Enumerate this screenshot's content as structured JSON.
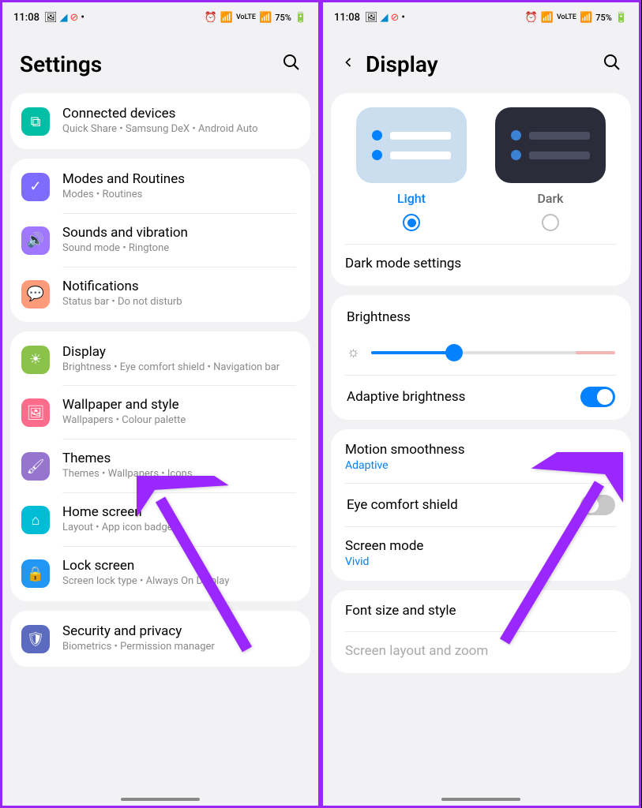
{
  "status": {
    "time": "11:08",
    "battery": "75%",
    "signal": "VoLTE",
    "icons": [
      "🖼",
      "✈",
      "⭕"
    ]
  },
  "left": {
    "title": "Settings",
    "items": [
      {
        "icon": "teal",
        "glyph": "⧉",
        "title": "Connected devices",
        "sub": "Quick Share  •  Samsung DeX  •  Android Auto"
      },
      {
        "icon": "purple",
        "glyph": "✓",
        "title": "Modes and Routines",
        "sub": "Modes  •  Routines"
      },
      {
        "icon": "purple2",
        "glyph": "🔊",
        "title": "Sounds and vibration",
        "sub": "Sound mode  •  Ringtone"
      },
      {
        "icon": "peach",
        "glyph": "💬",
        "title": "Notifications",
        "sub": "Status bar  •  Do not disturb"
      },
      {
        "icon": "green",
        "glyph": "☀",
        "title": "Display",
        "sub": "Brightness  •  Eye comfort shield  •  Navigation bar"
      },
      {
        "icon": "pink",
        "glyph": "🖼",
        "title": "Wallpaper and style",
        "sub": "Wallpapers  •  Colour palette"
      },
      {
        "icon": "violet",
        "glyph": "🖌",
        "title": "Themes",
        "sub": "Themes  •  Wallpapers  •  Icons"
      },
      {
        "icon": "cyan",
        "glyph": "⌂",
        "title": "Home screen",
        "sub": "Layout  •  App icon badges"
      },
      {
        "icon": "blue",
        "glyph": "🔒",
        "title": "Lock screen",
        "sub": "Screen lock type  •  Always On Display"
      },
      {
        "icon": "navy",
        "glyph": "🛡",
        "title": "Security and privacy",
        "sub": "Biometrics  •  Permission manager"
      }
    ]
  },
  "right": {
    "title": "Display",
    "theme_light": "Light",
    "theme_dark": "Dark",
    "dark_mode_settings": "Dark mode settings",
    "brightness": "Brightness",
    "adaptive_brightness": "Adaptive brightness",
    "motion_smoothness": "Motion smoothness",
    "motion_value": "Adaptive",
    "eye_comfort": "Eye comfort shield",
    "screen_mode": "Screen mode",
    "screen_mode_value": "Vivid",
    "font_size": "Font size and style",
    "screen_layout": "Screen layout and zoom"
  }
}
